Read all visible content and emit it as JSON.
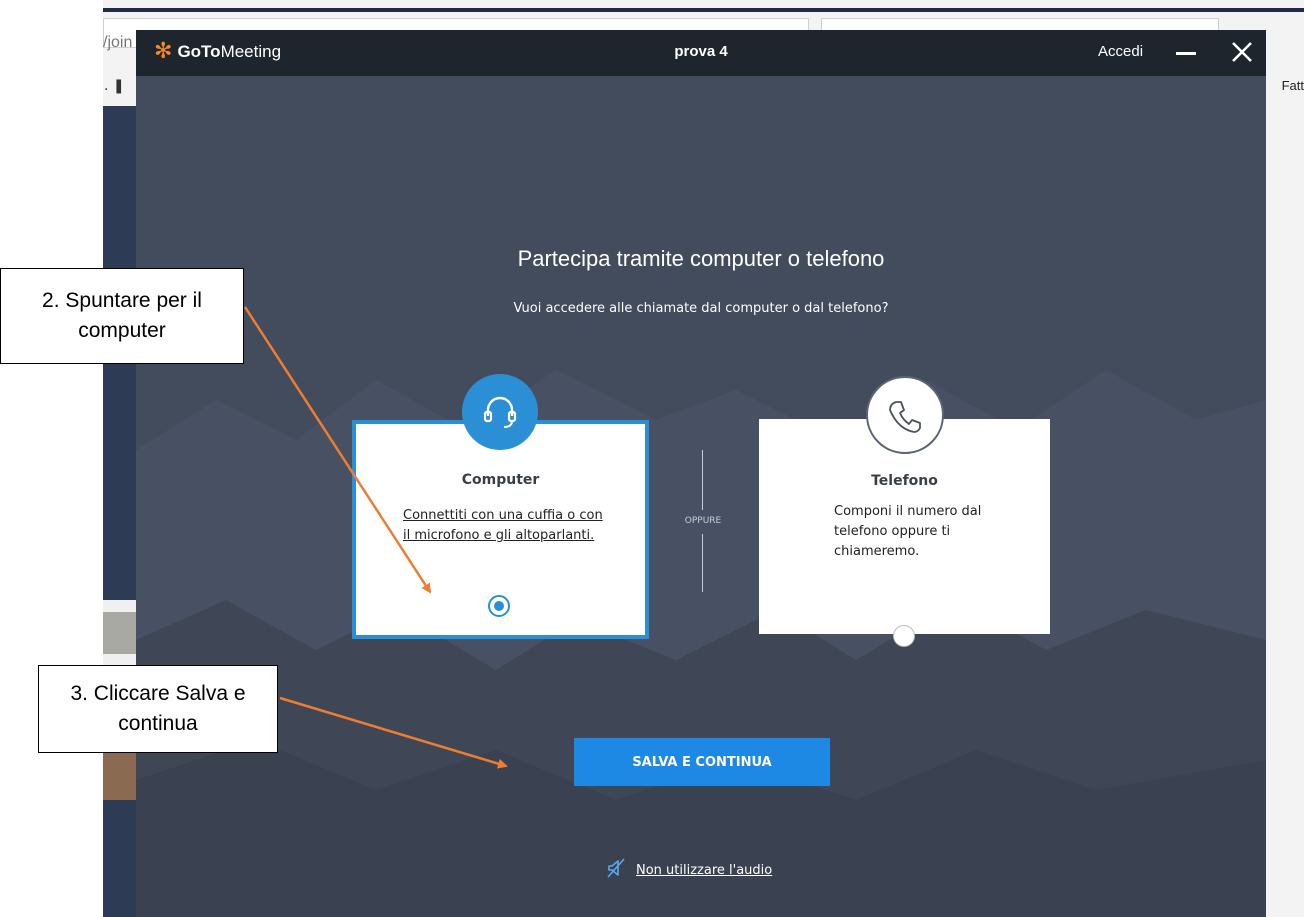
{
  "browser": {
    "url_fragment": "/join",
    "bookmarks_right": "Fatt"
  },
  "app": {
    "logo_bold": "GoTo",
    "logo_regular": "Meeting",
    "window_title": "prova 4",
    "signin_label": "Accedi",
    "heading": "Partecipa tramite computer o telefono",
    "subheading": "Vuoi accedere alle chiamate dal computer o dal telefono?",
    "divider_label": "OPPURE",
    "options": [
      {
        "title": "Computer",
        "description": "Connettiti con una cuffia o con il microfono e gli altoparlanti.",
        "icon": "headset-icon",
        "selected": true
      },
      {
        "title": "Telefono",
        "description": "Componi il numero dal telefono oppure ti chiameremo.",
        "icon": "phone-icon",
        "selected": false
      }
    ],
    "save_button_label": "SALVA E CONTINUA",
    "no_audio_label": "Non utilizzare l'audio",
    "colors": {
      "accent": "#1e88e5",
      "background": "#434c5c",
      "titlebar": "#1f252d",
      "logo_orange": "#f58a1f"
    }
  },
  "annotations": [
    {
      "text": "2.  Spuntare per il computer",
      "color": "#ed7d31"
    },
    {
      "text": "3. Cliccare Salva e continua",
      "color": "#ed7d31"
    }
  ]
}
